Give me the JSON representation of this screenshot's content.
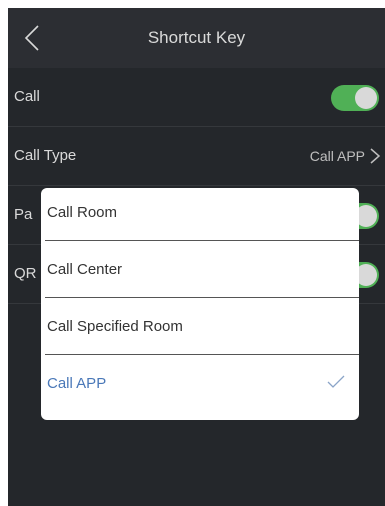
{
  "header": {
    "title": "Shortcut Key"
  },
  "settings": {
    "call": {
      "label": "Call",
      "enabled": true
    },
    "call_type": {
      "label": "Call Type",
      "value": "Call APP"
    },
    "password": {
      "label": "Pa",
      "enabled": true
    },
    "qr_code": {
      "label": "QR",
      "enabled": true
    }
  },
  "dialog": {
    "options": [
      {
        "label": "Call Room",
        "selected": false
      },
      {
        "label": "Call Center",
        "selected": false
      },
      {
        "label": "Call Specified Room",
        "selected": false
      },
      {
        "label": "Call APP",
        "selected": true
      }
    ]
  },
  "colors": {
    "background": "#2b2e33",
    "header": "#34373c",
    "toggle_on": "#5fcf65",
    "selected_text": "#4a78b8"
  },
  "icons": {
    "back": "chevron-left-icon",
    "arrow": "chevron-right-icon",
    "selected": "check-icon"
  }
}
